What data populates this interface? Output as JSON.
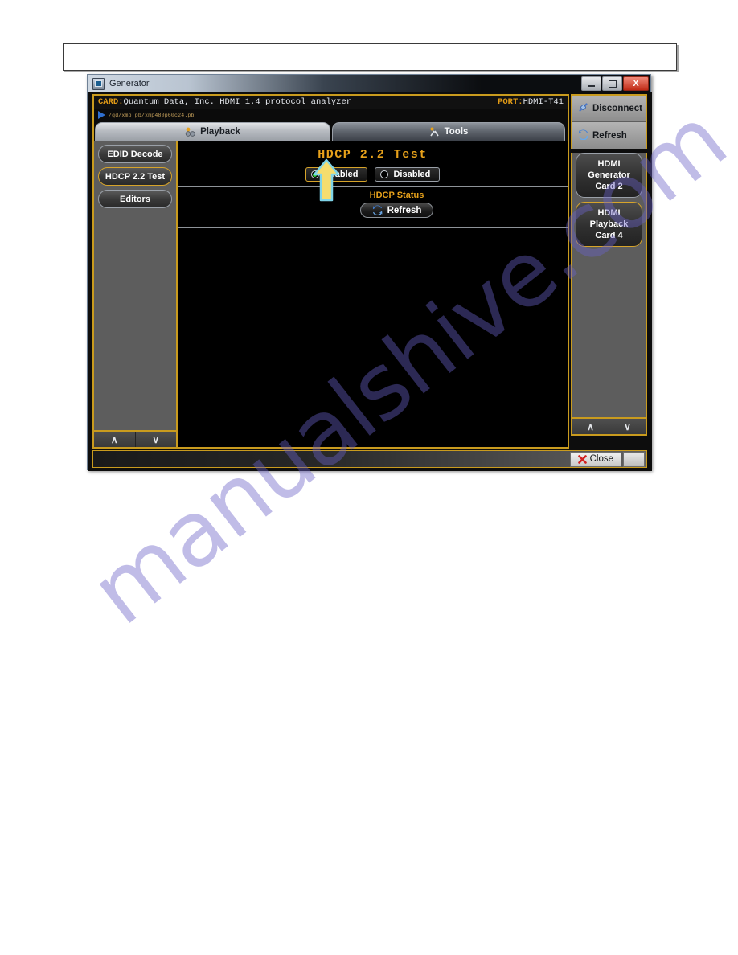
{
  "document": {
    "header_box_text": "",
    "watermark": "manualshive.com"
  },
  "window": {
    "title": "Generator",
    "icon": "monitor-icon",
    "minimize_label": "",
    "maximize_label": "",
    "close_label": "X"
  },
  "card_bar": {
    "card_label": "CARD:",
    "card_value": "Quantum Data, Inc. HDMI 1.4 protocol analyzer",
    "port_label": "PORT:",
    "port_value": "HDMI-T41"
  },
  "path_bar": {
    "play_icon": "play-triangle-icon",
    "path": "/qd/xmp_pb/xmp480p60c24.pb"
  },
  "tabs": [
    {
      "label": "Playback",
      "icon": "playback-icon",
      "active": true
    },
    {
      "label": "Tools",
      "icon": "tools-icon",
      "active": false
    }
  ],
  "left_sidebar": {
    "items": [
      {
        "label": "EDID Decode",
        "selected": false
      },
      {
        "label": "HDCP 2.2 Test",
        "selected": true
      },
      {
        "label": "Editors",
        "selected": false
      }
    ],
    "nav_up": "∧",
    "nav_down": "∨"
  },
  "content": {
    "title": "HDCP 2.2 Test",
    "options": [
      {
        "label": "Enabled",
        "selected": true
      },
      {
        "label": "Disabled",
        "selected": false
      }
    ],
    "status_label": "HDCP Status",
    "refresh_label": "Refresh",
    "refresh_icon": "refresh-arrows-icon",
    "annotation_arrow": "up-arrow-annotation"
  },
  "right_sidebar": {
    "actions": [
      {
        "label": "Disconnect",
        "icon": "disconnect-plug-icon"
      },
      {
        "label": "Refresh",
        "icon": "refresh-arrows-icon"
      }
    ],
    "cards": [
      {
        "lines": [
          "HDMI",
          "Generator",
          "Card 2"
        ],
        "selected": false
      },
      {
        "lines": [
          "HDMI",
          "Playback",
          "Card 4"
        ],
        "selected": true
      }
    ],
    "nav_up": "∧",
    "nav_down": "∨"
  },
  "status_bar": {
    "close_label": "Close",
    "close_icon": "red-x-icon"
  },
  "colors": {
    "accent_gold": "#c99b1e",
    "title_orange": "#e8a21b",
    "selected_green": "#2fd32f",
    "panel_gray": "#5d5d5d",
    "content_black": "#000000",
    "watermark_purple": "#6a62c8",
    "arrow_yellow": "#f5dd6e",
    "arrow_outline": "#7fd4e8"
  }
}
